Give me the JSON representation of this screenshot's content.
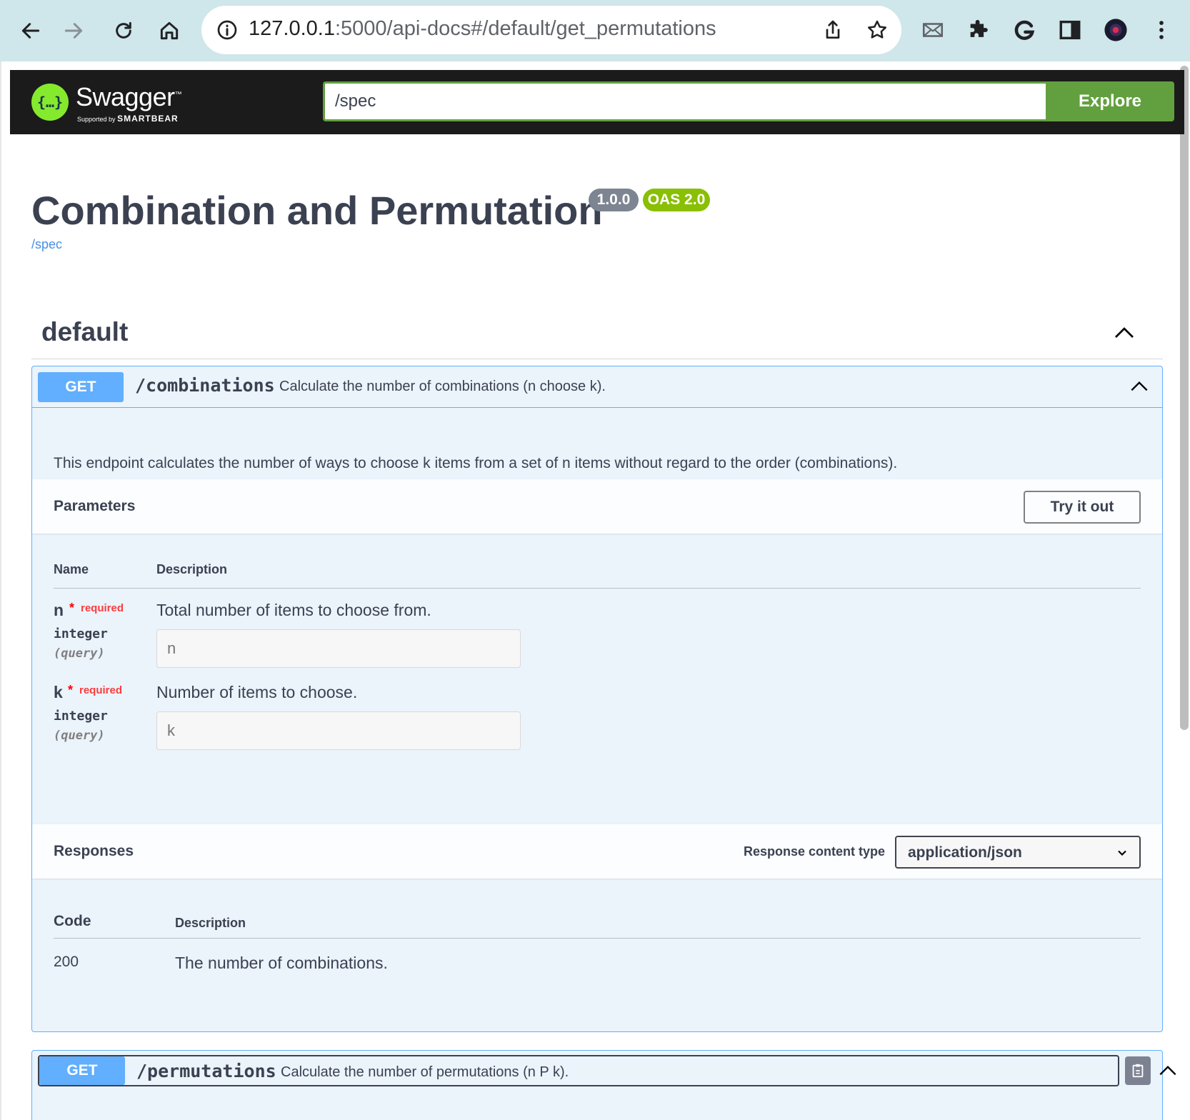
{
  "browser": {
    "url_host": "127.0.0.1",
    "url_rest": ":5000/api-docs#/default/get_permutations"
  },
  "topbar": {
    "logo_word": "Swagger",
    "logo_sub_small": "Supported by",
    "logo_sub_brand": "SMARTBEAR",
    "spec_value": "/spec",
    "explore_label": "Explore"
  },
  "info": {
    "title": "Combination and Permutation",
    "version": "1.0.0",
    "oas": "OAS 2.0",
    "spec_link": "/spec"
  },
  "tag": {
    "name": "default"
  },
  "combinations": {
    "method": "GET",
    "path": "/combinations",
    "summary": "Calculate the number of combinations (n choose k).",
    "description": "This endpoint calculates the number of ways to choose k items from a set of n items without regard to the order (combinations).",
    "parameters_label": "Parameters",
    "try_label": "Try it out",
    "col_name": "Name",
    "col_description": "Description",
    "params": [
      {
        "name": "n",
        "star": "*",
        "required": "required",
        "type": "integer",
        "in": "(query)",
        "description": "Total number of items to choose from.",
        "placeholder": "n"
      },
      {
        "name": "k",
        "star": "*",
        "required": "required",
        "type": "integer",
        "in": "(query)",
        "description": "Number of items to choose.",
        "placeholder": "k"
      }
    ],
    "responses_label": "Responses",
    "response_content_type_label": "Response content type",
    "response_content_type": "application/json",
    "code_header": "Code",
    "code_desc_header": "Description",
    "responses": [
      {
        "code": "200",
        "description": "The number of combinations."
      }
    ]
  },
  "permutations": {
    "method": "GET",
    "path": "/permutations",
    "summary": "Calculate the number of permutations (n P k)."
  }
}
